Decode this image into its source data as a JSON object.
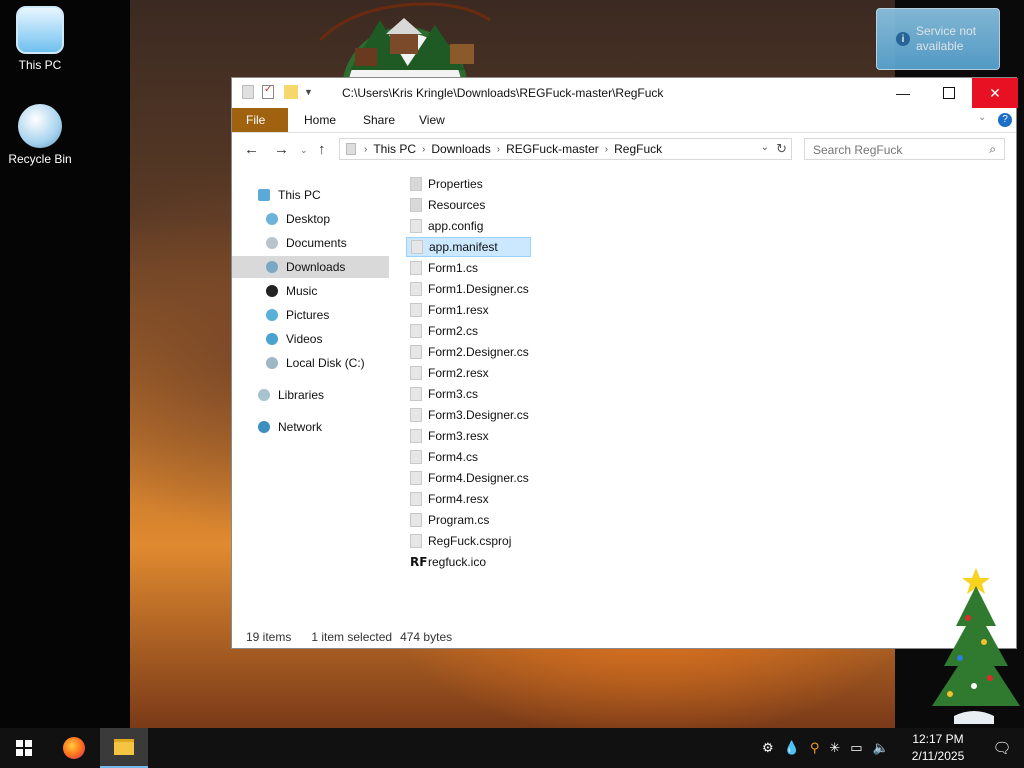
{
  "desktop": {
    "icons": [
      {
        "label": "This PC"
      },
      {
        "label": "Recycle Bin"
      }
    ]
  },
  "notification": {
    "text": "Service not available"
  },
  "explorer": {
    "title_path": "C:\\Users\\Kris Kringle\\Downloads\\REGFuck-master\\RegFuck",
    "ribbon_tabs": [
      "File",
      "Home",
      "Share",
      "View"
    ],
    "breadcrumb": [
      "This PC",
      "Downloads",
      "REGFuck-master",
      "RegFuck"
    ],
    "search_placeholder": "Search RegFuck",
    "nav_pane": [
      {
        "label": "This PC",
        "level": 1
      },
      {
        "label": "Desktop",
        "level": 2
      },
      {
        "label": "Documents",
        "level": 2
      },
      {
        "label": "Downloads",
        "level": 2,
        "selected": true
      },
      {
        "label": "Music",
        "level": 2
      },
      {
        "label": "Pictures",
        "level": 2
      },
      {
        "label": "Videos",
        "level": 2
      },
      {
        "label": "Local Disk (C:)",
        "level": 2
      },
      {
        "label": "Libraries",
        "level": 1
      },
      {
        "label": "Network",
        "level": 1
      }
    ],
    "files": [
      {
        "name": "Properties",
        "type": "folder"
      },
      {
        "name": "Resources",
        "type": "folder"
      },
      {
        "name": "app.config",
        "type": "file"
      },
      {
        "name": "app.manifest",
        "type": "file",
        "selected": true
      },
      {
        "name": "Form1.cs",
        "type": "file"
      },
      {
        "name": "Form1.Designer.cs",
        "type": "file"
      },
      {
        "name": "Form1.resx",
        "type": "file"
      },
      {
        "name": "Form2.cs",
        "type": "file"
      },
      {
        "name": "Form2.Designer.cs",
        "type": "file"
      },
      {
        "name": "Form2.resx",
        "type": "file"
      },
      {
        "name": "Form3.cs",
        "type": "file"
      },
      {
        "name": "Form3.Designer.cs",
        "type": "file"
      },
      {
        "name": "Form3.resx",
        "type": "file"
      },
      {
        "name": "Form4.cs",
        "type": "file"
      },
      {
        "name": "Form4.Designer.cs",
        "type": "file"
      },
      {
        "name": "Form4.resx",
        "type": "file"
      },
      {
        "name": "Program.cs",
        "type": "file"
      },
      {
        "name": "RegFuck.csproj",
        "type": "file"
      },
      {
        "name": "regfuck.ico",
        "type": "icon",
        "glyph": "RF"
      }
    ],
    "status": {
      "items": "19 items",
      "selection": "1 item selected",
      "size": "474 bytes"
    }
  },
  "taskbar": {
    "clock_time": "12:17 PM",
    "clock_date": "2/11/2025"
  },
  "colors": {
    "file_tab": "#a0620f",
    "close_button": "#e81123",
    "selection": "#cce8ff"
  }
}
